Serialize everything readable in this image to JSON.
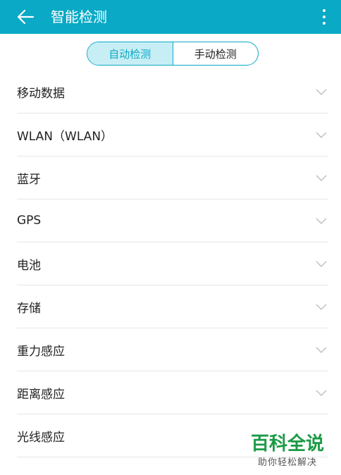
{
  "appbar": {
    "title": "智能检测",
    "back_icon": "arrow-left-icon",
    "more_icon": "more-vert-icon",
    "background": "#0aa9c6"
  },
  "segments": {
    "auto": "自动检测",
    "manual": "手动检测",
    "selected": "自动检测"
  },
  "items": [
    {
      "label": "移动数据"
    },
    {
      "label": "WLAN（WLAN）"
    },
    {
      "label": "蓝牙"
    },
    {
      "label": "GPS"
    },
    {
      "label": "电池"
    },
    {
      "label": "存储"
    },
    {
      "label": "重力感应"
    },
    {
      "label": "距离感应"
    },
    {
      "label": "光线感应"
    }
  ],
  "watermark": {
    "title": "百科全说",
    "subtitle": "助你轻松解决"
  }
}
